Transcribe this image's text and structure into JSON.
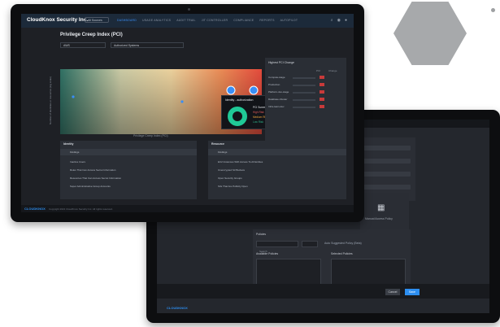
{
  "front": {
    "app_title": "CloudKnox Security Inc.",
    "account_selector": "All Sources",
    "nav_tabs": [
      "DASHBOARD",
      "USAGE ANALYTICS",
      "AUDIT TRAIL",
      "JIT CONTROLLER",
      "COMPLIANCE",
      "REPORTS",
      "AUTOPILOT"
    ],
    "active_tab_index": 0,
    "page_title": "Privilege Creep Index (PCI)",
    "filter_system": "AWS",
    "filter_scope": "Authorized Systems",
    "chart": {
      "xlabel": "Privilege Creep Index (PCI)",
      "ylabel": "Number of identities or resources (log scale)"
    },
    "popup": {
      "title": "Identity - authorization",
      "close": "x",
      "lines": [
        "PCI Summary",
        "High Risk",
        "Medium Risk",
        "Low Risk"
      ]
    },
    "right_panel": {
      "title": "Highest PCI Change",
      "col_pci": "PCI",
      "col_change": "Change",
      "rows": [
        {
          "name": "Compute-stage"
        },
        {
          "name": "Production"
        },
        {
          "name": "Platform-dev-stage"
        },
        {
          "name": "Database-Cluster"
        },
        {
          "name": "Infra-team-dev"
        }
      ]
    },
    "identity": {
      "title": "Identity",
      "sub": "Findings",
      "items": [
        "Inactive Users",
        "Roles That Can Access Secret Information",
        "Resources That Can Access Secret Information",
        "Super Administrative Group Accounts"
      ]
    },
    "resource": {
      "title": "Resource",
      "sub": "Findings",
      "items": [
        "EC2 Instances With Access To All Entities",
        "Unencrypted S3 Buckets",
        "Open Security Groups",
        "S3s That Are Publicly Open"
      ]
    },
    "footer_brand": "CLOUDKNOX",
    "footer_copy": "Copyright 2021 CloudKnox Security Inc. All rights reserved."
  },
  "back": {
    "grid_caption": "Manual Access Policy",
    "form_title": "Policies",
    "search_placeholder": "Search",
    "option_label": "Auto Suggested Policy (Beta)",
    "left_list_title": "Available Policies",
    "right_list_title": "Selected Policies",
    "cancel_label": "Cancel",
    "save_label": "Save",
    "footer_brand": "CLOUDKNOX",
    "footer_copy": "Copyright 2021 CloudKnox Security Inc. All rights reserved."
  },
  "colors": {
    "accent": "#2d8ef0",
    "background": "#1e2025",
    "nav": "#1c2a3a",
    "hexagon": "#a7a9ab"
  }
}
